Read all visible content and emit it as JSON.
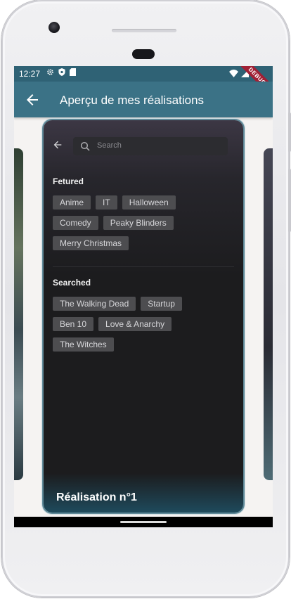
{
  "status_bar": {
    "time": "12:27",
    "debug_label": "DEBUG"
  },
  "app_bar": {
    "title": "Aperçu de mes réalisations"
  },
  "card": {
    "caption": "Réalisation n°1",
    "search_placeholder": "Search",
    "featured": {
      "title": "Fetured",
      "tags": [
        "Anime",
        "IT",
        "Halloween",
        "Comedy",
        "Peaky Blinders",
        "Merry Christmas"
      ]
    },
    "searched": {
      "title": "Searched",
      "tags": [
        "The Walking Dead",
        "Startup",
        "Ben 10",
        "Love & Anarchy",
        "The Witches"
      ]
    }
  },
  "colors": {
    "app_bar": "#3b7286",
    "status_bar": "#2f6275",
    "screen_background": "#f5f3f2",
    "card_background": "#1c1c1e",
    "chip": "#4d4d50",
    "debug_banner": "#a12035"
  }
}
